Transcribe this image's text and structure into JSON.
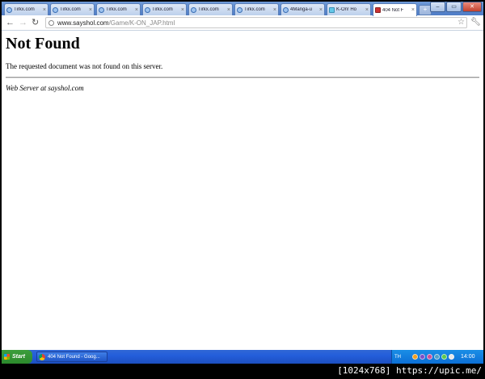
{
  "tabs": [
    {
      "label": "Tirkx.com",
      "icon": "globe-icon"
    },
    {
      "label": "Tirkx.com",
      "icon": "globe-icon"
    },
    {
      "label": "Tirkx.com",
      "icon": "globe-icon"
    },
    {
      "label": "Tirkx.com",
      "icon": "globe-icon"
    },
    {
      "label": "Tirkx.com",
      "icon": "globe-icon"
    },
    {
      "label": "Tirkx.com",
      "icon": "globe-icon"
    },
    {
      "label": "4Manga-u",
      "icon": "globe-icon"
    },
    {
      "label": "K-On! Ho",
      "icon": "site-icon"
    },
    {
      "label": "404 Not F",
      "icon": "site-icon",
      "active": true
    }
  ],
  "toolbar": {
    "url_domain": "www.sayshol.com",
    "url_path": "/Game/K-ON_JAP.html"
  },
  "page": {
    "heading": "Not Found",
    "message": "The requested document was not found on this server.",
    "address": "Web Server at sayshol.com"
  },
  "taskbar": {
    "start_label": "Start",
    "task_label": "404 Not Found - Goog...",
    "lang": "TH",
    "clock": "14:00"
  },
  "caption": "[1024x768] https://upic.me/",
  "colors": {
    "taskbar": "#245edb",
    "start": "#3c9e3c",
    "tabstrip": "#6f9ad8"
  }
}
